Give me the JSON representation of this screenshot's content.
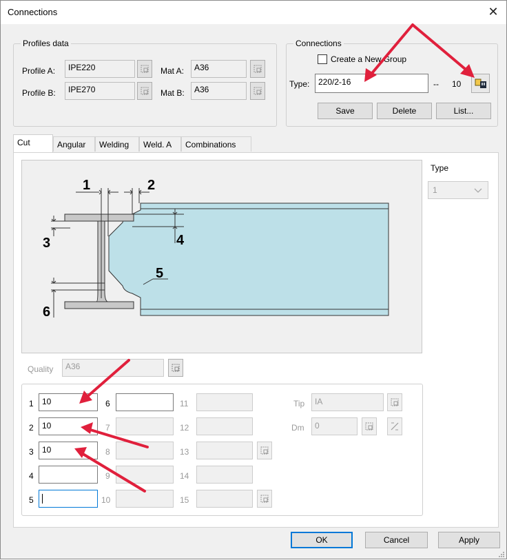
{
  "window": {
    "title": "Connections"
  },
  "profiles": {
    "legend": "Profiles data",
    "profile_a_label": "Profile A:",
    "profile_a_value": "IPE220",
    "profile_b_label": "Profile B:",
    "profile_b_value": "IPE270",
    "mat_a_label": "Mat A:",
    "mat_a_value": "A36",
    "mat_b_label": "Mat B:",
    "mat_b_value": "A36"
  },
  "connections": {
    "legend": "Connections",
    "create_group_label": "Create a New Group",
    "create_group_checked": false,
    "type_label": "Type:",
    "type_value": "220/2-16",
    "dash": "--",
    "count": "10",
    "save_label": "Save",
    "delete_label": "Delete",
    "list_label": "List..."
  },
  "tabs": [
    "Cut",
    "Angular",
    "Welding",
    "Weld. A",
    "Combinations"
  ],
  "active_tab": "Cut",
  "type_select": {
    "label": "Type",
    "value": "1"
  },
  "diagram_labels": [
    "1",
    "2",
    "3",
    "4",
    "5",
    "6"
  ],
  "quality": {
    "label": "Quality",
    "value": "A36"
  },
  "fields": {
    "col1": [
      {
        "label": "1",
        "value": "10"
      },
      {
        "label": "2",
        "value": "10"
      },
      {
        "label": "3",
        "value": "10"
      },
      {
        "label": "4",
        "value": ""
      },
      {
        "label": "5",
        "value": ""
      }
    ],
    "col2": [
      {
        "label": "6",
        "value": ""
      },
      {
        "label": "7",
        "value": ""
      },
      {
        "label": "8",
        "value": ""
      },
      {
        "label": "9",
        "value": ""
      },
      {
        "label": "10",
        "value": ""
      }
    ],
    "col3": [
      {
        "label": "11",
        "value": ""
      },
      {
        "label": "12",
        "value": ""
      },
      {
        "label": "13",
        "value": ""
      },
      {
        "label": "14",
        "value": ""
      },
      {
        "label": "15",
        "value": ""
      }
    ]
  },
  "tip": {
    "label": "Tip",
    "value": "IA"
  },
  "dm": {
    "label": "Dm",
    "value": "0"
  },
  "footer": {
    "ok_label": "OK",
    "cancel_label": "Cancel",
    "apply_label": "Apply"
  },
  "colors": {
    "accent": "#0078d7",
    "beam_fill": "#bde0e8",
    "column_fill": "#c8c8c8",
    "annotation_arrow": "#e0203c"
  }
}
